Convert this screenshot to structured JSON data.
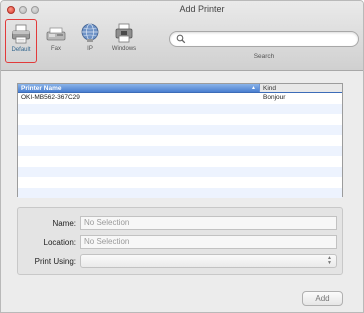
{
  "window": {
    "title": "Add Printer"
  },
  "toolbar": {
    "tools": [
      {
        "label": "Default",
        "icon": "printer-icon",
        "selected": true
      },
      {
        "label": "Fax",
        "icon": "fax-icon",
        "selected": false
      },
      {
        "label": "IP",
        "icon": "globe-icon",
        "selected": false
      },
      {
        "label": "Windows",
        "icon": "windows-printer-icon",
        "selected": false
      }
    ]
  },
  "search": {
    "value": "",
    "placeholder": "",
    "label": "Search"
  },
  "printer_list": {
    "columns": {
      "name": "Printer Name",
      "kind": "Kind"
    },
    "rows": [
      {
        "name": "OKI-MB562-367C29",
        "kind": "Bonjour"
      }
    ]
  },
  "form": {
    "name": {
      "label": "Name:",
      "value": "No Selection"
    },
    "location": {
      "label": "Location:",
      "value": "No Selection"
    },
    "print_using": {
      "label": "Print Using:",
      "value": ""
    }
  },
  "buttons": {
    "add": "Add"
  },
  "colors": {
    "selection_highlight": "#e23a3a",
    "header_blue": "#4a7fd0",
    "row_stripe": "#edf3fe"
  }
}
